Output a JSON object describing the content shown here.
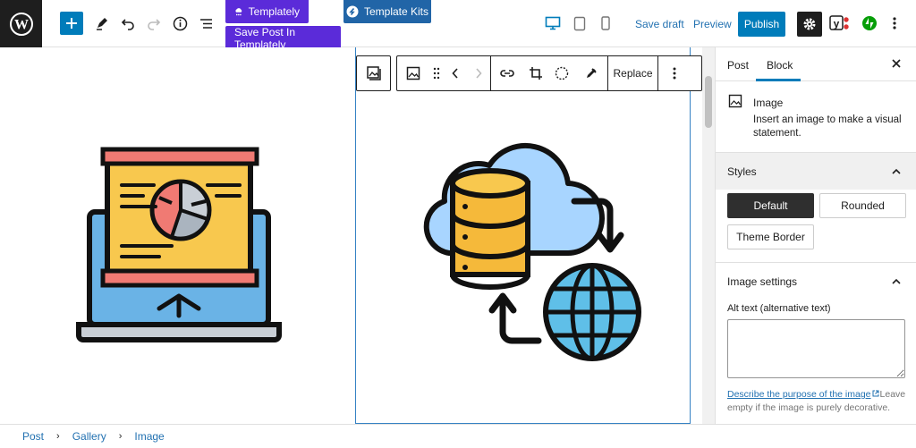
{
  "topbar": {
    "templately_label": "Templately",
    "save_templately_label": "Save Post In Templately",
    "template_kits_label": "Template Kits",
    "save_draft": "Save draft",
    "preview": "Preview",
    "publish": "Publish"
  },
  "toolbar": {
    "replace": "Replace"
  },
  "sidebar": {
    "tab_post": "Post",
    "tab_block": "Block",
    "block_name": "Image",
    "block_desc": "Insert an image to make a visual statement.",
    "styles_heading": "Styles",
    "style_default": "Default",
    "style_rounded": "Rounded",
    "style_theme_border": "Theme Border",
    "image_settings_heading": "Image settings",
    "alt_label": "Alt text (alternative text)",
    "alt_value": "",
    "alt_help_link": "Describe the purpose of the image",
    "alt_help_rest_1": "Leave",
    "alt_help_rest_2": "empty if the image is purely decorative."
  },
  "breadcrumb": {
    "items": [
      "Post",
      "Gallery",
      "Image"
    ]
  },
  "colors": {
    "accent": "#007cba",
    "templately": "#5b2bd9",
    "kits": "#2165a7",
    "dark": "#1e1e1e"
  }
}
